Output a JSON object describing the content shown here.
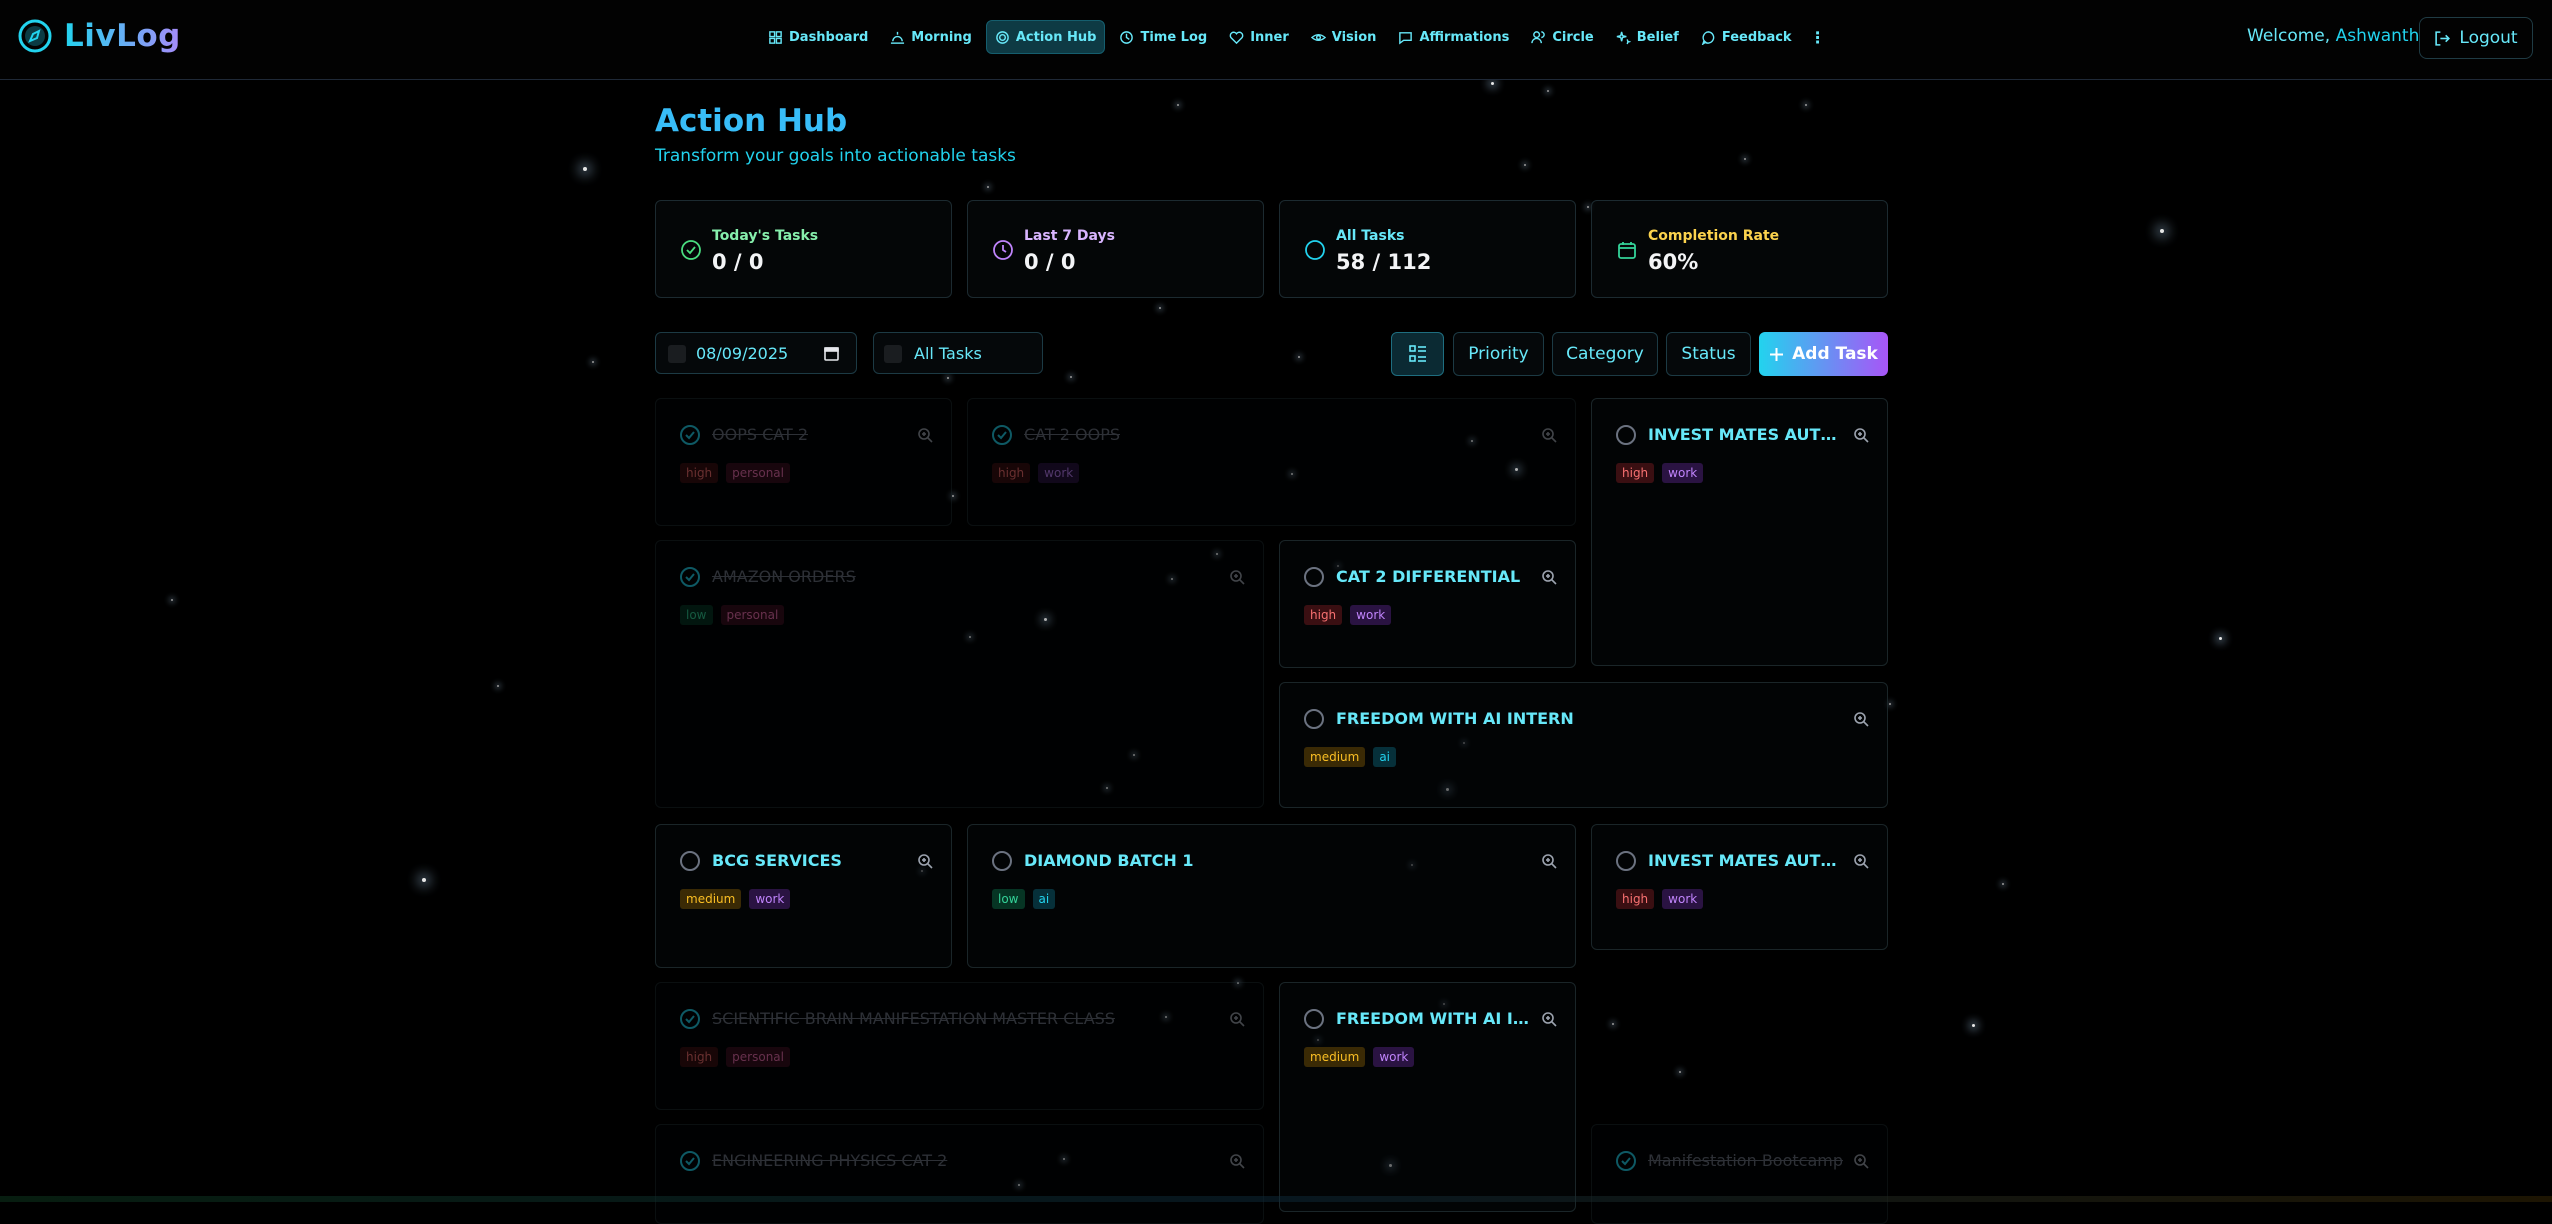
{
  "app": {
    "name": "LivLog"
  },
  "nav": {
    "items": [
      {
        "label": "Dashboard",
        "icon": "dashboard-icon"
      },
      {
        "label": "Morning",
        "icon": "morning-icon"
      },
      {
        "label": "Action Hub",
        "icon": "target-icon",
        "active": true
      },
      {
        "label": "Time Log",
        "icon": "clock-icon"
      },
      {
        "label": "Inner",
        "icon": "heart-icon"
      },
      {
        "label": "Vision",
        "icon": "eye-icon"
      },
      {
        "label": "Affirmations",
        "icon": "message-icon"
      },
      {
        "label": "Circle",
        "icon": "users-icon"
      },
      {
        "label": "Belief",
        "icon": "sparkle-icon"
      },
      {
        "label": "Feedback",
        "icon": "chat-icon"
      }
    ],
    "more": "⋮"
  },
  "user": {
    "welcome_prefix": "Welcome,",
    "name": "Ashwanth",
    "logout_label": "Logout"
  },
  "header": {
    "title": "Action Hub",
    "subtitle": "Transform your goals into actionable tasks"
  },
  "stats": [
    {
      "label": "Today's Tasks",
      "value": "0 / 0",
      "color": "#86efac"
    },
    {
      "label": "Last 7 Days",
      "value": "0 / 0",
      "color": "#d8b4fe"
    },
    {
      "label": "All Tasks",
      "value": "58 / 112",
      "color": "#67e8f9"
    },
    {
      "label": "Completion Rate",
      "value": "60%",
      "color": "#fcd34d"
    }
  ],
  "toolbar": {
    "date_value": "08/09/2025",
    "filter_value": "All Tasks",
    "priority_label": "Priority",
    "category_label": "Category",
    "status_label": "Status",
    "add_label": "Add Task"
  },
  "tasks": [
    {
      "title": "OOPS CAT 2",
      "done": true,
      "priority": "high",
      "category": "personal"
    },
    {
      "title": "CAT 2 OOPS",
      "done": true,
      "priority": "high",
      "category": "work"
    },
    {
      "title": "INVEST MATES AUTOMATION",
      "done": false,
      "priority": "high",
      "category": "work"
    },
    {
      "title": "AMAZON ORDERS",
      "done": true,
      "priority": "low",
      "category": "personal"
    },
    {
      "title": "CAT 2 DIFFERENTIAL",
      "done": false,
      "priority": "high",
      "category": "work"
    },
    {
      "title": "FREEDOM WITH AI INTERN",
      "done": false,
      "priority": "medium",
      "category": "ai"
    },
    {
      "title": "BCG SERVICES",
      "done": false,
      "priority": "medium",
      "category": "work"
    },
    {
      "title": "DIAMOND BATCH 1",
      "done": false,
      "priority": "low",
      "category": "ai"
    },
    {
      "title": "INVEST MATES AUTOMATION",
      "done": false,
      "priority": "high",
      "category": "work"
    },
    {
      "title": "SCIENTIFIC BRAIN MANIFESTATION MASTER CLASS",
      "done": true,
      "priority": "high",
      "category": "personal"
    },
    {
      "title": "FREEDOM WITH AI INTERNSHIP",
      "done": false,
      "priority": "medium",
      "category": "work"
    },
    {
      "title": "ENGINEERING PHYSICS CAT 2",
      "done": true,
      "priority": "",
      "category": ""
    },
    {
      "title": "Manifestation Bootcamp",
      "done": true,
      "priority": "",
      "category": ""
    }
  ],
  "colors": {
    "accent": "#22d3ee",
    "accent2": "#a855f7",
    "background": "#000000"
  }
}
